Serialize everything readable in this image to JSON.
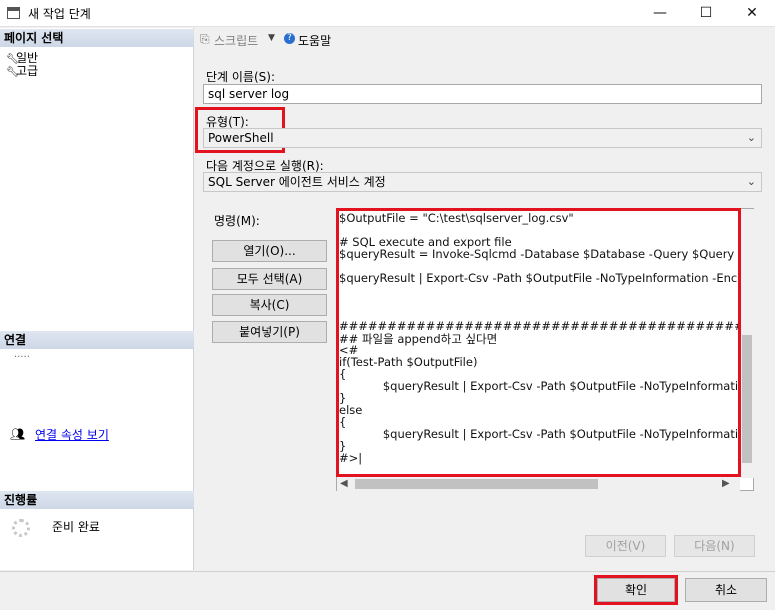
{
  "window": {
    "title": "새 작업 단계",
    "minimize": "—",
    "maximize": "☐",
    "close": "✕"
  },
  "left": {
    "select_page_header": "페이지 선택",
    "pages": [
      {
        "label": "일반",
        "icon": "wrench-icon"
      },
      {
        "label": "고급",
        "icon": "wrench-icon"
      }
    ],
    "connection_header": "연결",
    "connection_value": "·····",
    "connection_link": "연결 속성 보기",
    "progress_header": "진행률",
    "progress_status": "준비 완료"
  },
  "toolbar": {
    "script_label": "스크립트",
    "help_label": "도움말"
  },
  "form": {
    "step_name_label": "단계 이름(S):",
    "step_name_value": "sql server log",
    "type_label": "유형(T):",
    "type_value": "PowerShell",
    "run_as_label": "다음 계정으로 실행(R):",
    "run_as_value": "SQL Server 에이전트 서비스 계정",
    "command_label": "명령(M):"
  },
  "command_buttons": {
    "open": "열기(O)...",
    "select_all": "모두 선택(A)",
    "copy": "복사(C)",
    "paste": "붙여넣기(P)"
  },
  "editor_lines": [
    "$OutputFile = \"C:\\test\\sqlserver_log.csv\"",
    "",
    "# SQL execute and export file",
    "$queryResult = Invoke-Sqlcmd -Database $Database -Query $Query",
    "",
    "$queryResult | Export-Csv -Path $OutputFile -NoTypeInformation -Encod",
    "",
    "",
    "",
    "###########################################################",
    "## 파일을 append하고 싶다면",
    "<#",
    "if(Test-Path $OutputFile)",
    "{",
    "            $queryResult | Export-Csv -Path $OutputFile -NoTypeInformatio",
    "}",
    "else",
    "{",
    "            $queryResult | Export-Csv -Path $OutputFile -NoTypeInformatio",
    "}",
    "#>|"
  ],
  "nav_buttons": {
    "prev": "이전(V)",
    "next": "다음(N)"
  },
  "footer": {
    "ok": "확인",
    "cancel": "취소"
  },
  "colors": {
    "highlight": "#e2131f",
    "section_header": "#d6dfec",
    "link": "#0000ee"
  }
}
